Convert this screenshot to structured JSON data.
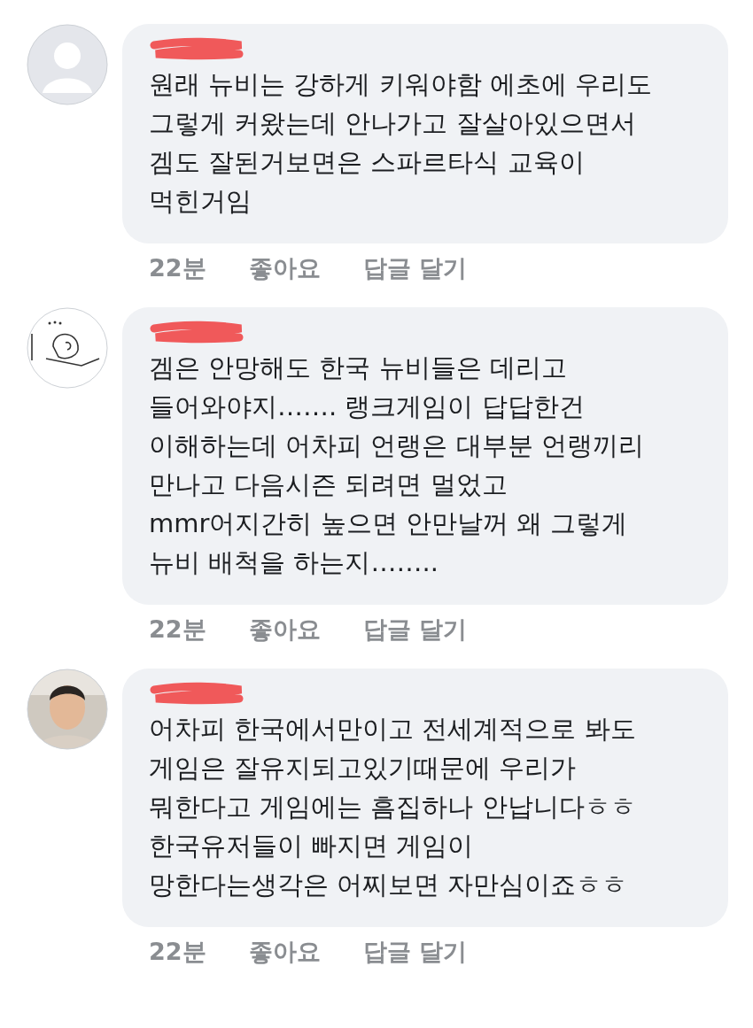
{
  "comments": [
    {
      "avatar": {
        "kind": "default"
      },
      "author": {
        "redacted": true
      },
      "text": "원래 뉴비는 강하게 키워야함 에초에 우리도\n그렇게 커왔는데 안나가고 잘살아있으면서\n겜도 잘된거보면은 스파르타식 교육이\n먹힌거임",
      "time": "22분",
      "like": "좋아요",
      "reply": "답글 달기"
    },
    {
      "avatar": {
        "kind": "sketch"
      },
      "author": {
        "redacted": true
      },
      "text": "겜은 안망해도 한국 뉴비들은 데리고\n들어와야지……. 랭크게임이 답답한건\n이해하는데 어차피 언랭은 대부분 언랭끼리\n만나고 다음시즌 되려면 멀었고\nmmr어지간히 높으면 안만날꺼 왜 그렇게\n뉴비 배척을 하는지……..",
      "time": "22분",
      "like": "좋아요",
      "reply": "답글 달기"
    },
    {
      "avatar": {
        "kind": "photo"
      },
      "author": {
        "redacted": true
      },
      "text": "어차피 한국에서만이고 전세계적으로 봐도\n게임은 잘유지되고있기때문에 우리가\n뭐한다고 게임에는 흠집하나 안납니다ㅎㅎ\n한국유저들이 빠지면 게임이\n망한다는생각은 어찌보면 자만심이죠ㅎㅎ",
      "time": "22분",
      "like": "좋아요",
      "reply": "답글 달기"
    }
  ]
}
